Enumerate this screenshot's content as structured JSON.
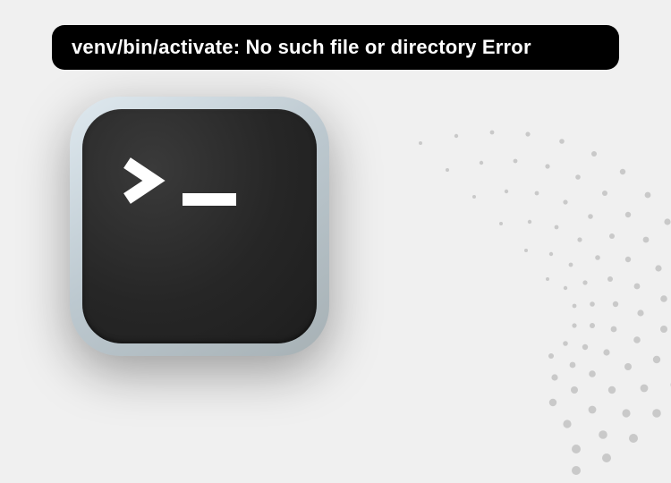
{
  "title": "venv/bin/activate: No such file or directory Error",
  "icon": {
    "semantic": "terminal-icon"
  },
  "colors": {
    "background": "#f0f0f0",
    "badgeBg": "#000000",
    "badgeText": "#ffffff",
    "terminalOuterLight": "#dfe9ef",
    "terminalOuterDark": "#a7b1b5",
    "terminalInner": "#262626",
    "promptGlyph": "#ffffff",
    "dots": "#c9c9c9"
  }
}
